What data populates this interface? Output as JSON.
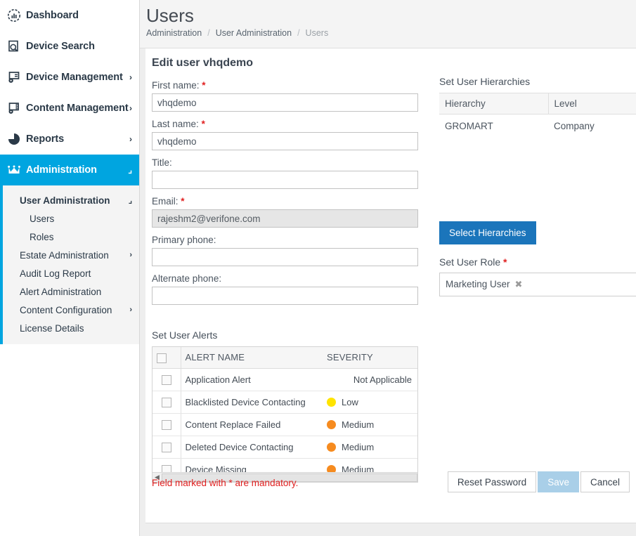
{
  "sidebar": {
    "items": [
      {
        "label": "Dashboard",
        "icon": "dashboard-gauge-icon",
        "caret": "",
        "active": false
      },
      {
        "label": "Device Search",
        "icon": "device-search-icon",
        "caret": "",
        "active": false
      },
      {
        "label": "Device Management",
        "icon": "device-management-icon",
        "caret": "›",
        "active": false
      },
      {
        "label": "Content Management",
        "icon": "content-management-icon",
        "caret": "›",
        "active": false
      },
      {
        "label": "Reports",
        "icon": "pie-chart-icon",
        "caret": "›",
        "active": false
      },
      {
        "label": "Administration",
        "icon": "crown-icon",
        "caret": "⌐",
        "active": true
      }
    ],
    "submenu": [
      {
        "label": "User Administration",
        "caret": "⌐",
        "level": 1,
        "head": true
      },
      {
        "label": "Users",
        "caret": "",
        "level": 2,
        "head": false
      },
      {
        "label": "Roles",
        "caret": "",
        "level": 2,
        "head": false
      },
      {
        "label": "Estate Administration",
        "caret": "›",
        "level": 1,
        "head": false
      },
      {
        "label": "Audit Log Report",
        "caret": "",
        "level": 1,
        "head": false
      },
      {
        "label": "Alert Administration",
        "caret": "",
        "level": 1,
        "head": false
      },
      {
        "label": "Content Configuration",
        "caret": "›",
        "level": 1,
        "head": false
      },
      {
        "label": "License Details",
        "caret": "",
        "level": 1,
        "head": false
      }
    ]
  },
  "header": {
    "title": "Users",
    "breadcrumb": [
      {
        "label": "Administration",
        "current": false
      },
      {
        "label": "User Administration",
        "current": false
      },
      {
        "label": "Users",
        "current": true
      }
    ],
    "separator": "/"
  },
  "form": {
    "section_title": "Edit user vhqdemo",
    "fields": [
      {
        "label": "First name:",
        "required": true,
        "value": "vhqdemo",
        "placeholder": "",
        "disabled": false
      },
      {
        "label": "Last name:",
        "required": true,
        "value": "vhqdemo",
        "placeholder": "",
        "disabled": false
      },
      {
        "label": "Title:",
        "required": false,
        "value": "",
        "placeholder": "",
        "disabled": false
      },
      {
        "label": "Email:",
        "required": true,
        "value": "rajeshm2@verifone.com",
        "placeholder": "",
        "disabled": true
      },
      {
        "label": "Primary phone:",
        "required": false,
        "value": "",
        "placeholder": "",
        "disabled": false
      },
      {
        "label": "Alternate phone:",
        "required": false,
        "value": "",
        "placeholder": "",
        "disabled": false
      }
    ],
    "required_marker": "*",
    "mandatory_note": "Field marked with * are mandatory."
  },
  "alerts": {
    "title": "Set User Alerts",
    "columns": [
      "ALERT NAME",
      "SEVERITY"
    ],
    "rows": [
      {
        "name": "Application Alert",
        "severity": "Not Applicable",
        "color": "",
        "checked": false
      },
      {
        "name": "Blacklisted Device Contacting",
        "severity": "Low",
        "color": "#ffe400",
        "checked": false
      },
      {
        "name": "Content Replace Failed",
        "severity": "Medium",
        "color": "#f68b1f",
        "checked": false
      },
      {
        "name": "Deleted Device Contacting",
        "severity": "Medium",
        "color": "#f68b1f",
        "checked": false
      },
      {
        "name": "Device Missing",
        "severity": "Medium",
        "color": "#f68b1f",
        "checked": false
      }
    ],
    "scroll_left_arrow": "◀"
  },
  "hierarchies": {
    "title": "Set User Hierarchies",
    "columns": [
      "Hierarchy",
      "Level"
    ],
    "rows": [
      {
        "hierarchy": "GROMART",
        "level": "Company"
      }
    ],
    "select_button": "Select Hierarchies"
  },
  "role": {
    "title": "Set User Role",
    "required_marker": "*",
    "selected": "Marketing User",
    "remove_icon": "✖"
  },
  "footer": {
    "reset_password": "Reset Password",
    "save": "Save",
    "cancel": "Cancel"
  },
  "colors": {
    "sidebar_active": "#00a5e0",
    "primary_button": "#1b75bb",
    "save_disabled": "#a9cfe8",
    "required_red": "#e02020",
    "severity_low": "#ffe400",
    "severity_medium": "#f68b1f"
  }
}
